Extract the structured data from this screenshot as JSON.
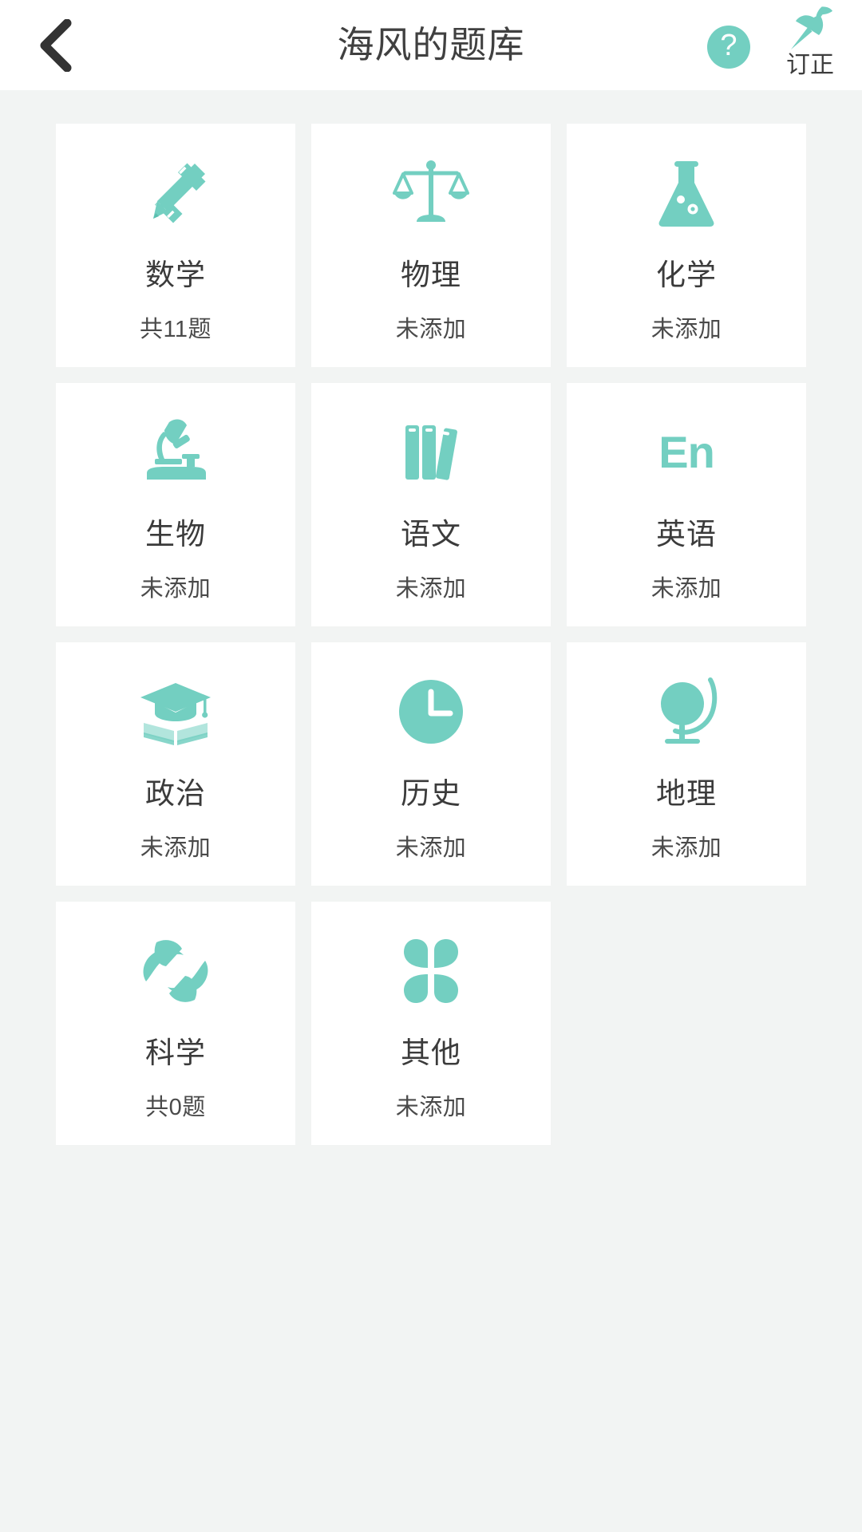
{
  "theme": {
    "accent": "#73cfc1",
    "page_background": "#f2f4f3",
    "header_background": "#ffffff",
    "card_background": "#ffffff",
    "title_text_color": "#404040",
    "card_title_color": "#3b3b3b",
    "card_sub_color": "#4a4a4a"
  },
  "header": {
    "title": "海风的题库",
    "back_icon": "chevron-left-icon",
    "help_icon": "question-mark-icon",
    "help_glyph": "?",
    "pin_icon": "pushpin-icon",
    "pin_label": "订正"
  },
  "grid": {
    "columns": 3,
    "cards": [
      {
        "title": "数学",
        "status": "共11题",
        "icon": "pencil-ruler-icon",
        "count": 11,
        "added": true
      },
      {
        "title": "物理",
        "status": "未添加",
        "icon": "balance-scale-icon",
        "count": null,
        "added": false
      },
      {
        "title": "化学",
        "status": "未添加",
        "icon": "flask-icon",
        "count": null,
        "added": false
      },
      {
        "title": "生物",
        "status": "未添加",
        "icon": "microscope-icon",
        "count": null,
        "added": false
      },
      {
        "title": "语文",
        "status": "未添加",
        "icon": "books-icon",
        "count": null,
        "added": false
      },
      {
        "title": "英语",
        "status": "未添加",
        "icon": "en-text-icon",
        "count": null,
        "added": false
      },
      {
        "title": "政治",
        "status": "未添加",
        "icon": "graduation-cap-book-icon",
        "count": null,
        "added": false
      },
      {
        "title": "历史",
        "status": "未添加",
        "icon": "clock-icon",
        "count": null,
        "added": false
      },
      {
        "title": "地理",
        "status": "未添加",
        "icon": "globe-stand-icon",
        "count": null,
        "added": false
      },
      {
        "title": "科学",
        "status": "共0题",
        "icon": "atom-orbit-icon",
        "count": 0,
        "added": true
      },
      {
        "title": "其他",
        "status": "未添加",
        "icon": "four-petal-icon",
        "count": null,
        "added": false
      }
    ]
  }
}
